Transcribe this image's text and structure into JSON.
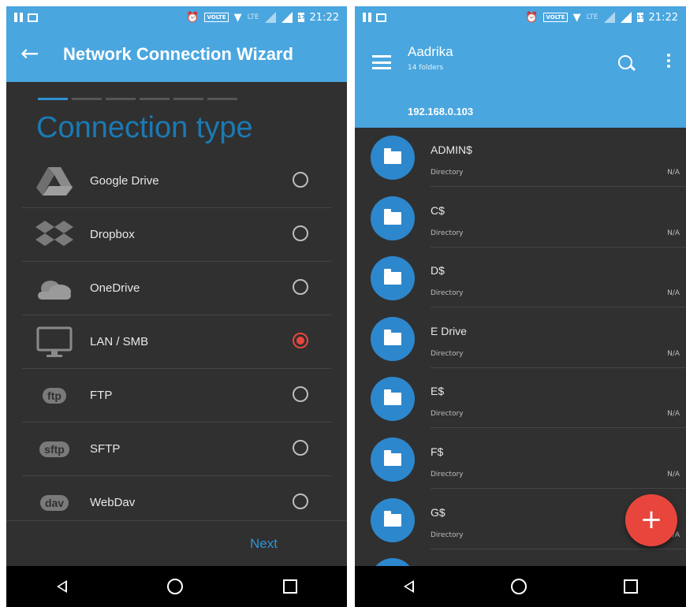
{
  "status_bar": {
    "time": "21:22",
    "volte": "VOLTE",
    "lte": "LTE",
    "battery": "17"
  },
  "left": {
    "title": "Network Connection Wizard",
    "section_title": "Connection type",
    "connections": [
      {
        "label": "Google Drive",
        "icon": "google-drive-icon",
        "selected": false
      },
      {
        "label": "Dropbox",
        "icon": "dropbox-icon",
        "selected": false
      },
      {
        "label": "OneDrive",
        "icon": "onedrive-icon",
        "selected": false
      },
      {
        "label": "LAN / SMB",
        "icon": "monitor-icon",
        "selected": true
      },
      {
        "label": "FTP",
        "icon": "ftp-icon",
        "icon_text": "ftp",
        "selected": false
      },
      {
        "label": "SFTP",
        "icon": "sftp-icon",
        "icon_text": "sftp",
        "selected": false
      },
      {
        "label": "WebDav",
        "icon": "webdav-icon",
        "icon_text": "dav",
        "selected": false
      }
    ],
    "next_label": "Next"
  },
  "right": {
    "title": "Aadrika",
    "subtitle": "14 folders",
    "host": "192.168.0.103",
    "directories": [
      {
        "name": "ADMIN$",
        "type": "Directory",
        "size": "N/A"
      },
      {
        "name": "C$",
        "type": "Directory",
        "size": "N/A"
      },
      {
        "name": "D$",
        "type": "Directory",
        "size": "N/A"
      },
      {
        "name": "E Drive",
        "type": "Directory",
        "size": "N/A"
      },
      {
        "name": "E$",
        "type": "Directory",
        "size": "N/A"
      },
      {
        "name": "F$",
        "type": "Directory",
        "size": "N/A"
      },
      {
        "name": "G$",
        "type": "Directory",
        "size": "N/A"
      }
    ],
    "fab_label": "+"
  },
  "colors": {
    "accent": "#4aa6df",
    "folder": "#2d87cd",
    "selected": "#e8463d",
    "background": "#303030"
  }
}
